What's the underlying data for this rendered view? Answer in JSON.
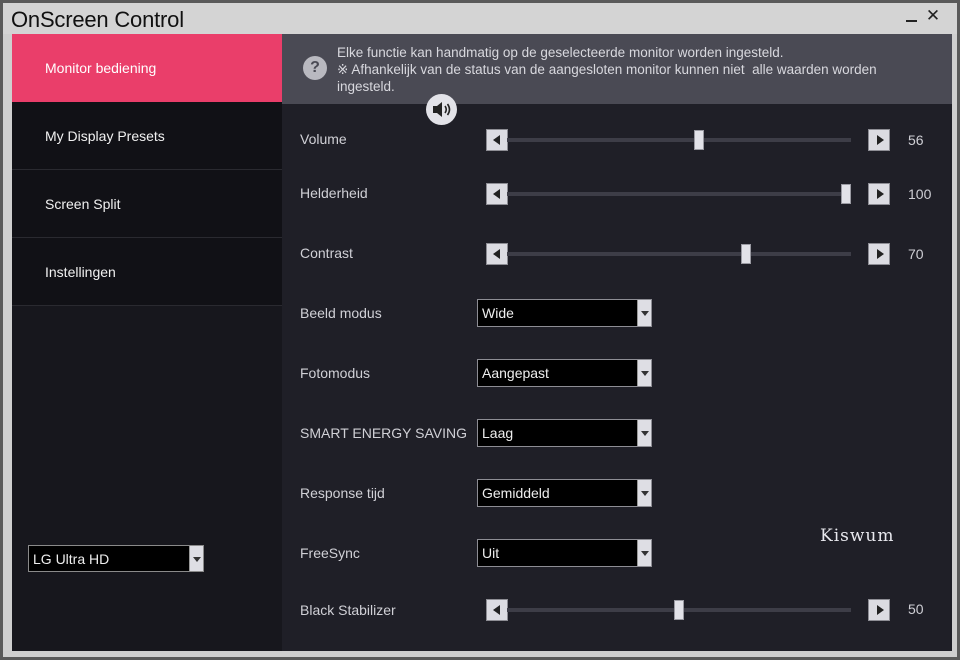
{
  "window": {
    "title": "OnScreen Control",
    "minimize_glyph": "",
    "close_glyph": "✕"
  },
  "sidebar": {
    "items": [
      {
        "label": "Monitor bediening",
        "active": true
      },
      {
        "label": "My Display Presets",
        "active": false
      },
      {
        "label": "Screen Split",
        "active": false
      },
      {
        "label": "Instellingen",
        "active": false
      }
    ],
    "monitor_select": {
      "value": "LG Ultra HD"
    }
  },
  "info": {
    "icon": "?",
    "line1": "Elke functie kan handmatig op de geselecteerde monitor worden ingesteld.",
    "line2": "※ Afhankelijk van de status van de aangesloten monitor kunnen niet  alle waarden worden",
    "line3": "ingesteld."
  },
  "controls": {
    "volume": {
      "label": "Volume",
      "value": 56,
      "display": "56",
      "max": 100
    },
    "brightness": {
      "label": "Helderheid",
      "value": 100,
      "display": "100",
      "max": 100
    },
    "contrast": {
      "label": "Contrast",
      "value": 70,
      "display": "70",
      "max": 100
    },
    "picture_mode": {
      "label": "Beeld modus",
      "value": "Wide"
    },
    "photo_mode": {
      "label": "Fotomodus",
      "value": "Aangepast"
    },
    "smart_energy": {
      "label": "SMART ENERGY SAVING",
      "value": "Laag"
    },
    "response_time": {
      "label": "Response tijd",
      "value": "Gemiddeld"
    },
    "freesync": {
      "label": "FreeSync",
      "value": "Uit"
    },
    "black_stabilizer": {
      "label": "Black Stabilizer",
      "value": 50,
      "display": "50",
      "max": 100
    }
  },
  "watermark": "Kiswum",
  "colors": {
    "accent": "#ea3e6a",
    "panel": "#1f1f27",
    "sidebar": "#111116",
    "infobar": "#4a4a54"
  }
}
